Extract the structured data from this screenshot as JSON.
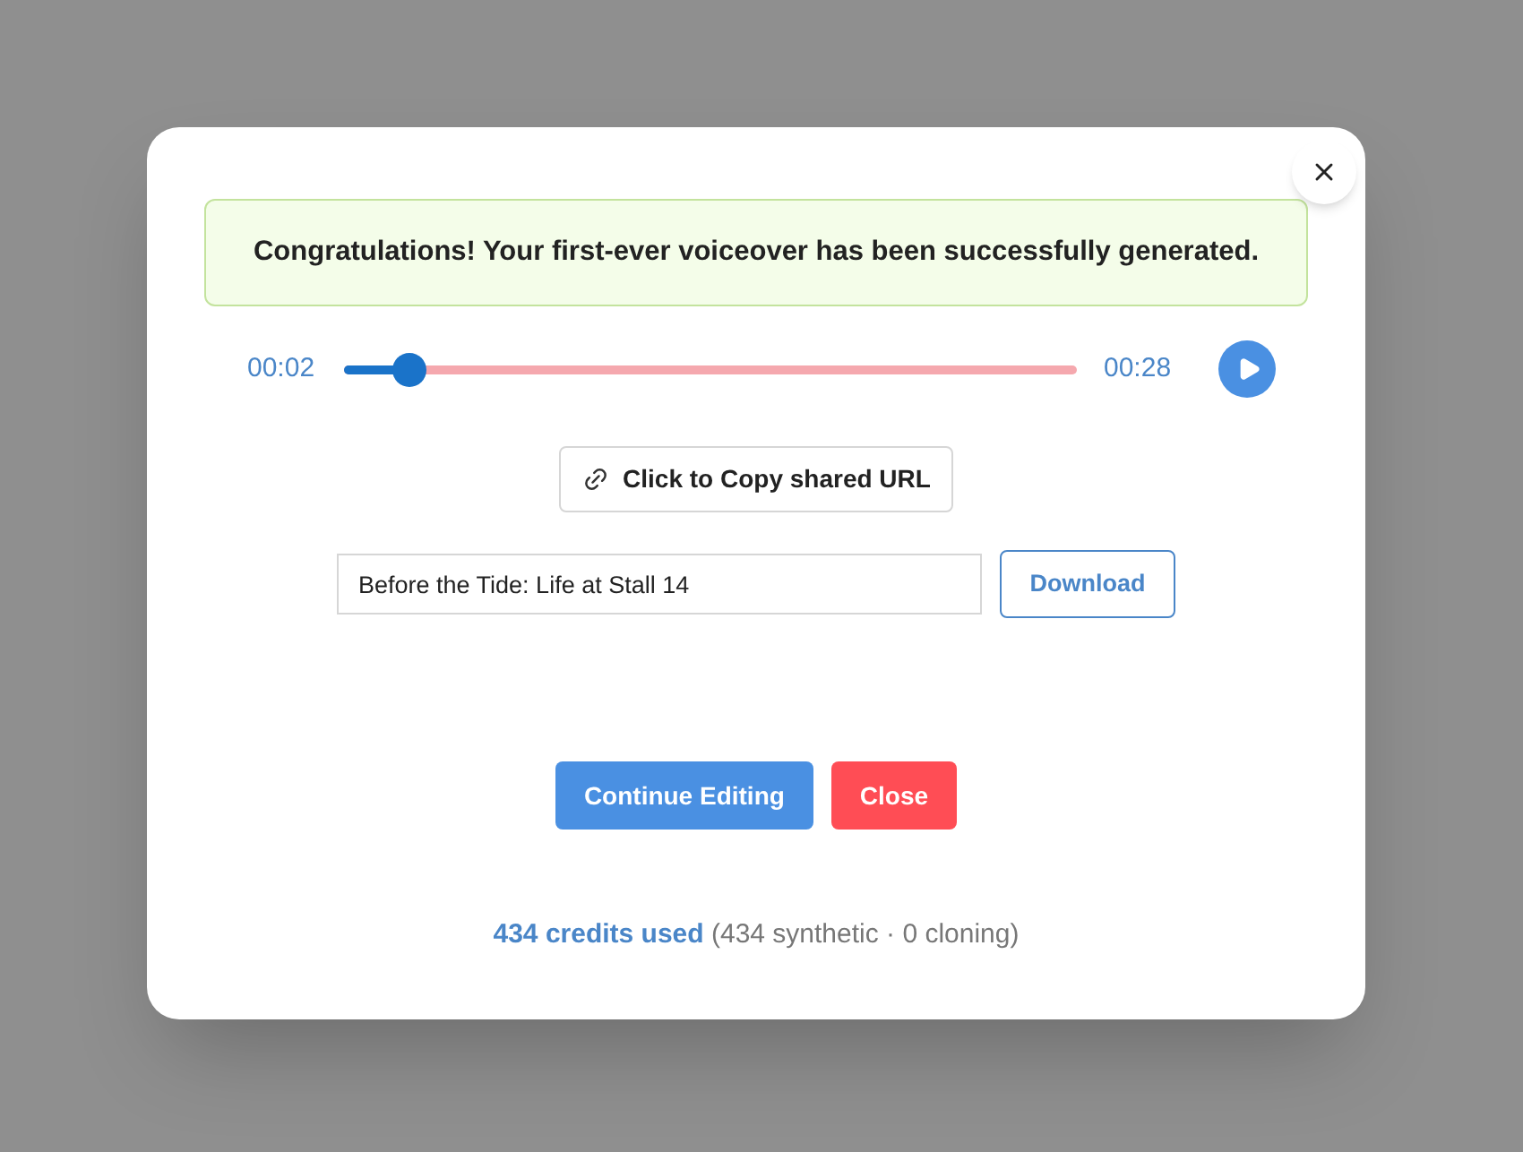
{
  "alert": {
    "message": "Congratulations! Your first-ever voiceover has been successfully generated."
  },
  "player": {
    "elapsed": "00:02",
    "duration": "00:28",
    "level": 0.087,
    "playing": false
  },
  "copy_button": {
    "label": "Click to Copy shared URL"
  },
  "title_field": {
    "value": "Before the Tide: Life at Stall 14"
  },
  "download_button": {
    "label": "Download"
  },
  "actions": [
    {
      "label": "Continue Editing",
      "kind": "primary"
    },
    {
      "label": "Close",
      "kind": "danger"
    }
  ],
  "credits": "**434 credits used** (434 synthetic · 0 cloning)"
}
